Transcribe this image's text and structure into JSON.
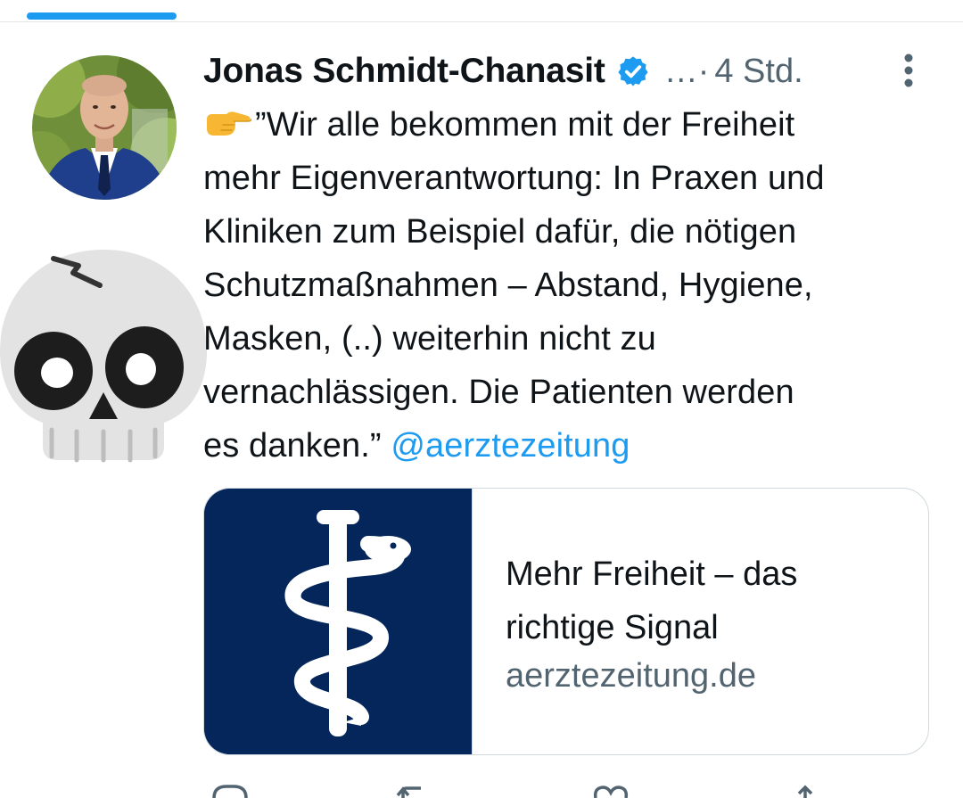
{
  "tweet": {
    "author_name": "Jonas Schmidt-Chanasit",
    "handle_truncated": "…·",
    "timestamp": "4 Std.",
    "text_line1": "”Wir alle bekommen mit der Freiheit",
    "text_line2": "mehr Eigenverantwortung: In Praxen und",
    "text_line3": "Kliniken zum Beispiel dafür, die nötigen",
    "text_line4": "Schutzmaßnahmen – Abstand, Hygiene,",
    "text_line5": "Masken, (..) weiterhin nicht zu",
    "text_line6": "vernachlässigen. Die Patienten werden",
    "text_line7_prefix": "es danken.” ",
    "mention": "@aerztezeitung"
  },
  "link_card": {
    "title_line1": "Mehr Freiheit – das",
    "title_line2": "richtige Signal",
    "domain": "aerztezeitung.de"
  },
  "colors": {
    "accent": "#1d9bf0",
    "secondary_text": "#536471",
    "card_image_bg": "#04265b"
  },
  "icons": {
    "verified": "verified-badge-icon",
    "more": "more-vertical-icon",
    "pointer": "backhand-index-pointing-right-emoji",
    "skull": "skull-emoji",
    "card_image": "staff-of-asclepius-logo"
  }
}
